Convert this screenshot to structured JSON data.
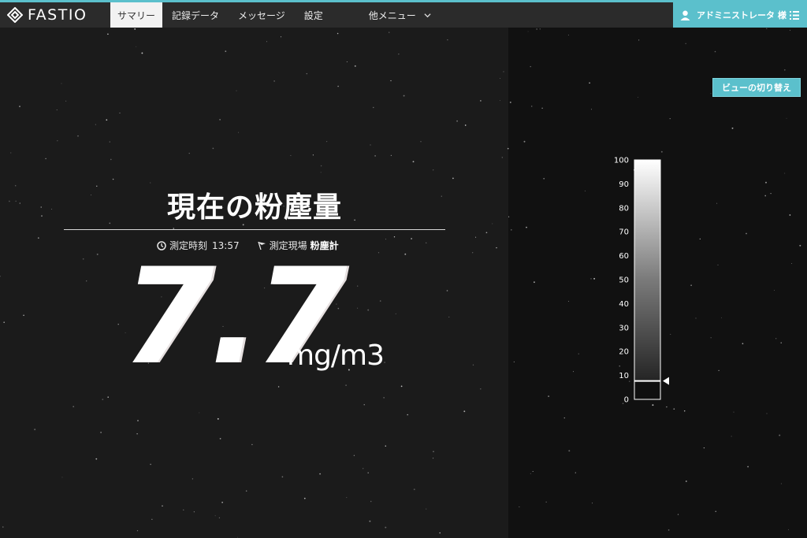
{
  "app": {
    "name": "FASTIO",
    "logo_icon": "fastio-logo-icon"
  },
  "nav": {
    "items": [
      {
        "label": "サマリー",
        "active": true
      },
      {
        "label": "記録データ",
        "active": false
      },
      {
        "label": "メッセージ",
        "active": false
      },
      {
        "label": "設定",
        "active": false
      }
    ],
    "more_label": "他メニュー"
  },
  "user": {
    "label": "アドミニストレータ 様"
  },
  "main": {
    "title": "現在の粉塵量",
    "time_label": "測定時刻",
    "time_value": "13:57",
    "site_label": "測定現場",
    "site_value": "粉塵計",
    "reading": "7.7",
    "unit": "mg/m3"
  },
  "view_toggle_label": "ビューの切り替え",
  "gauge": {
    "min": 0,
    "max": 100,
    "ticks": [
      "100",
      "90",
      "80",
      "70",
      "60",
      "50",
      "40",
      "30",
      "20",
      "10",
      "0"
    ],
    "value": 7.7
  },
  "colors": {
    "accent": "#5bc0cc",
    "navbar": "#2b2b2b",
    "background": "#1b1b1b",
    "panel_right": "#111111"
  }
}
